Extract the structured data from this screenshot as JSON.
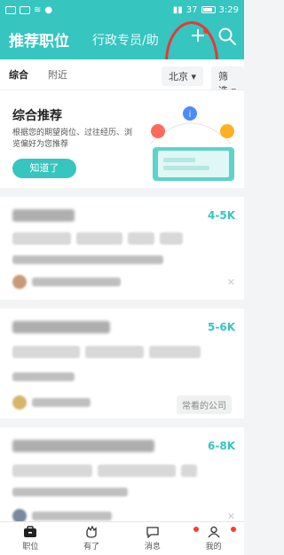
{
  "status_bar": {
    "battery": "37",
    "time": "3:29"
  },
  "header": {
    "title": "推荐职位",
    "tab_secondary": "行政专员/助"
  },
  "filters": {
    "tabs": [
      "综合",
      "附近"
    ],
    "city": "北京",
    "filter_label": "筛选"
  },
  "recommend": {
    "title": "综合推荐",
    "description": "根据您的期望岗位、过往经历、浏览偏好为您推荐",
    "button_label": "知道了"
  },
  "jobs": [
    {
      "salary": "4-5K",
      "badge": ""
    },
    {
      "salary": "5-6K",
      "badge": "常看的公司"
    },
    {
      "salary": "6-8K",
      "badge": ""
    }
  ],
  "bottom_nav": [
    {
      "label": "职位",
      "icon": "briefcase-icon"
    },
    {
      "label": "有了",
      "icon": "hand-icon"
    },
    {
      "label": "消息",
      "icon": "chat-icon"
    },
    {
      "label": "我的",
      "icon": "profile-icon"
    }
  ],
  "colors": {
    "brand": "#36c5bf",
    "annotation": "#e53935",
    "notify_dot": "#ff3b30"
  }
}
